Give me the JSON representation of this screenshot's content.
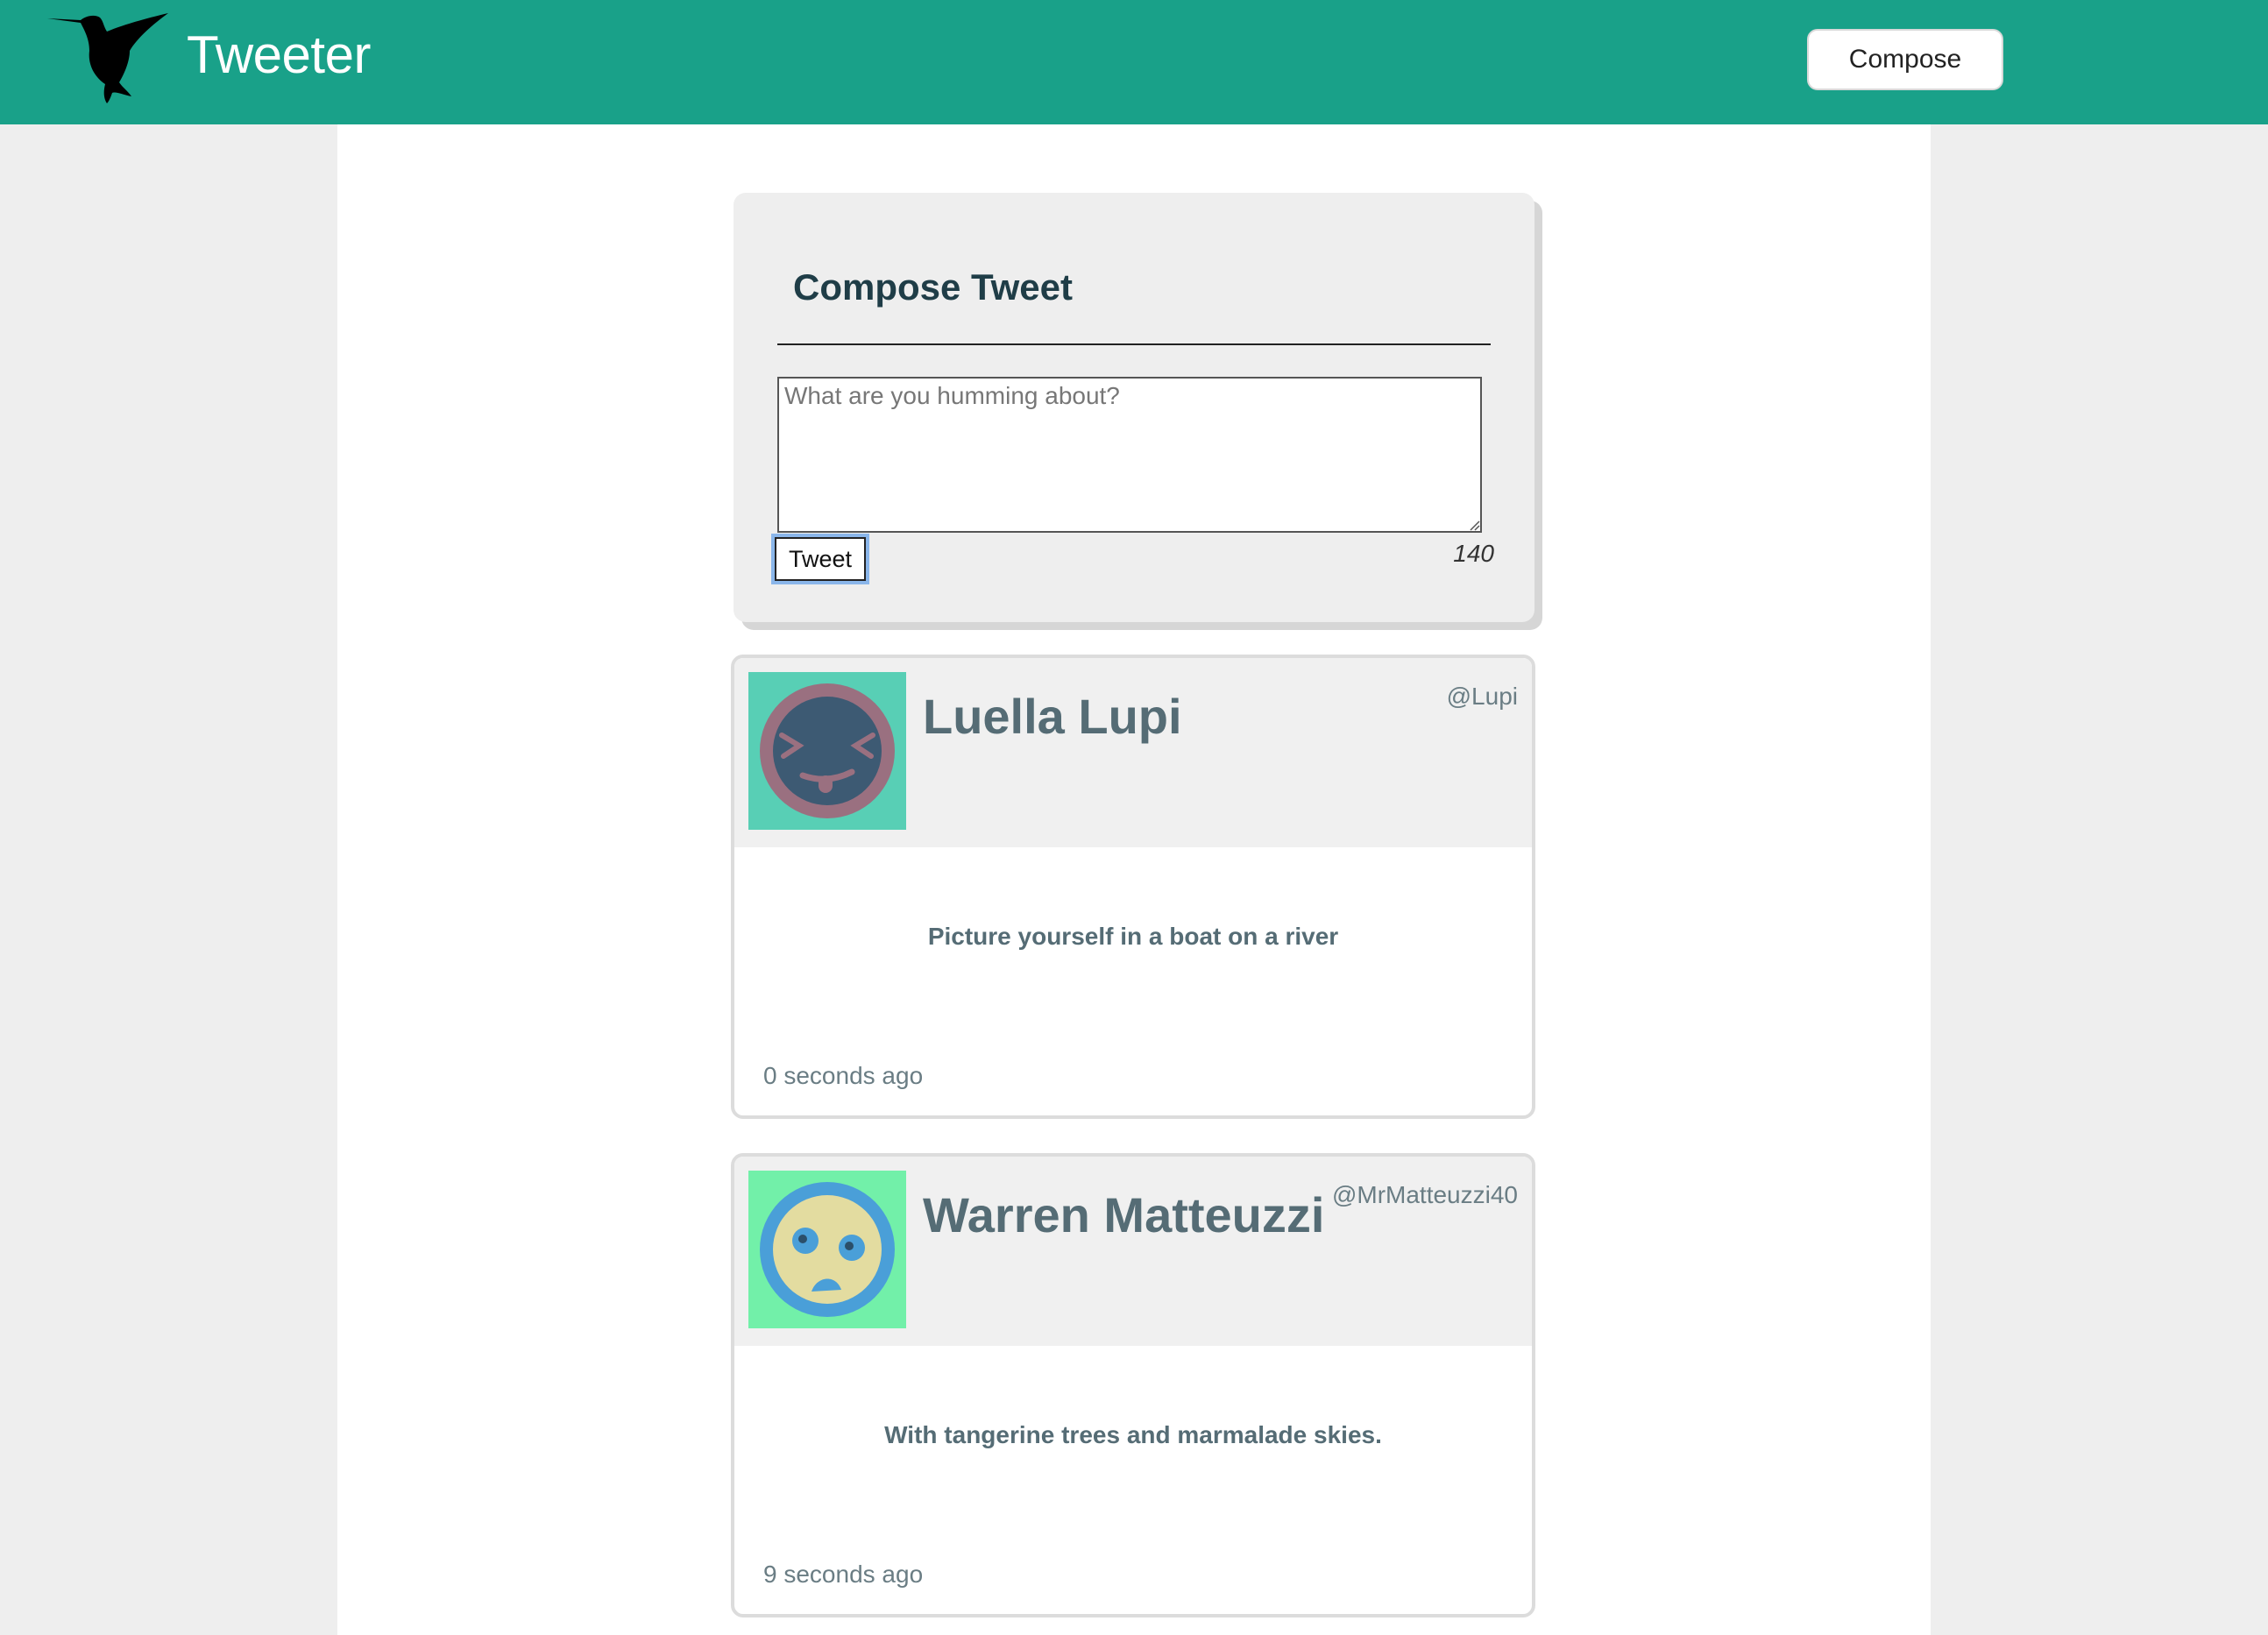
{
  "header": {
    "brand": "Tweeter",
    "compose_label": "Compose"
  },
  "composer": {
    "title": "Compose Tweet",
    "placeholder": "What are you humming about?",
    "submit_label": "Tweet",
    "char_count": "140"
  },
  "tweets": [
    {
      "name": "Luella Lupi",
      "handle": "@Lupi",
      "text": "Picture yourself in a boat on a river",
      "time": "0 seconds ago",
      "avatar_bg": "#58cfb5",
      "avatar_ring": "#9a7080",
      "avatar_face": "#3d5a73"
    },
    {
      "name": "Warren Matteuzzi",
      "handle": "@MrMatteuzzi40",
      "text": "With tangerine trees and marmalade skies.",
      "time": "9 seconds ago",
      "avatar_bg": "#72f0a9",
      "avatar_ring": "#4a9fd8",
      "avatar_face": "#e3dca0"
    }
  ],
  "colors": {
    "navbar": "#19a189",
    "page_bg": "#eeeeee",
    "text_accent": "#556c75"
  }
}
